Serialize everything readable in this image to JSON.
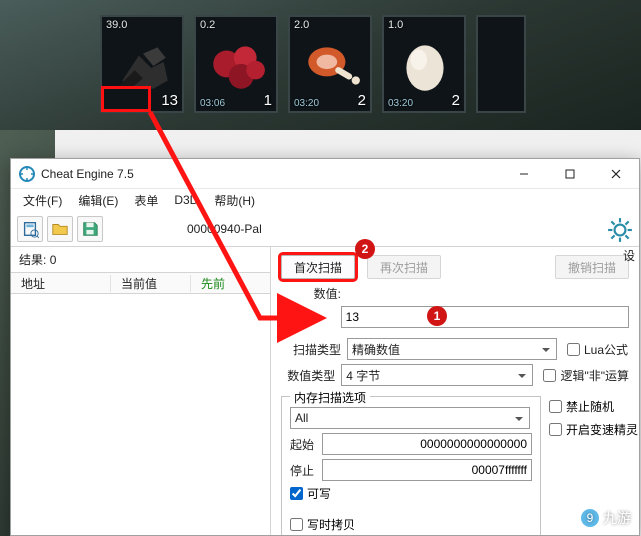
{
  "inventory": {
    "slots": [
      {
        "weight": "39.0",
        "count": "13",
        "timer": ""
      },
      {
        "weight": "0.2",
        "count": "1",
        "timer": "03:06"
      },
      {
        "weight": "2.0",
        "count": "2",
        "timer": "03:20"
      },
      {
        "weight": "1.0",
        "count": "2",
        "timer": "03:20"
      }
    ]
  },
  "titlebar": {
    "title": "Cheat Engine 7.5"
  },
  "menu": {
    "file": "文件(F)",
    "edit": "编辑(E)",
    "table": "表单",
    "d3d": "D3D",
    "help": "帮助(H)"
  },
  "toolbar": {
    "process": "00000940-Pal"
  },
  "left": {
    "results_label": "结果:",
    "results_count": "0",
    "col_addr": "地址",
    "col_value": "当前值",
    "col_prev": "先前"
  },
  "right": {
    "first_scan": "首次扫描",
    "next_scan": "再次扫描",
    "undo_scan": "撤销扫描",
    "settings": "设",
    "value_label": "数值:",
    "value_input": "13",
    "scan_type_label": "扫描类型",
    "scan_type_value": "精确数值",
    "value_type_label": "数值类型",
    "value_type_value": "4 字节",
    "lua_formula": "Lua公式",
    "not_logic": "逻辑\"非\"运算",
    "mem_options_legend": "内存扫描选项",
    "mem_range": "All",
    "start_label": "起始",
    "start_value": "0000000000000000",
    "stop_label": "停止",
    "stop_value": "00007fffffff",
    "writable": "可写",
    "copyonwrite": "写时拷贝",
    "no_random": "禁止随机",
    "speedhack": "开启变速精灵"
  },
  "annotations": {
    "step1": "1",
    "step2": "2"
  },
  "watermark": "九游"
}
